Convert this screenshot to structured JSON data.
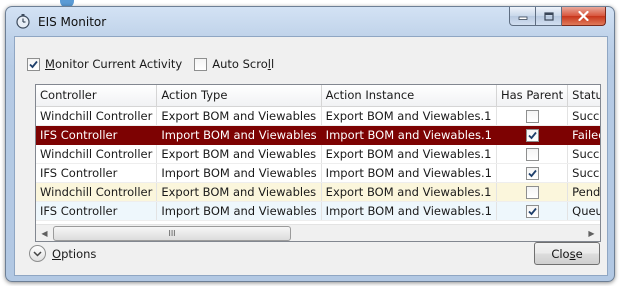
{
  "window": {
    "title": "EIS Monitor",
    "minimize_label": "Minimize",
    "maximize_label": "Maximize",
    "close_label": "Close window"
  },
  "toolbar": {
    "monitor_current_activity": {
      "pre": "",
      "u": "M",
      "post": "onitor Current Activity",
      "checked": true
    },
    "auto_scroll": {
      "pre": "Auto Scro",
      "u": "l",
      "post": "l",
      "checked": false
    }
  },
  "grid": {
    "columns": [
      "Controller",
      "Action Type",
      "Action Instance",
      "Has Parent",
      "Status"
    ],
    "rows": [
      {
        "controller": "Windchill Controller",
        "action_type": "Export BOM and Viewables",
        "action_instance": "Export BOM and Viewables.1",
        "has_parent": false,
        "status": "Succeeded",
        "state": "normal"
      },
      {
        "controller": "IFS Controller",
        "action_type": "Import BOM and Viewables",
        "action_instance": "Import BOM and Viewables.1",
        "has_parent": true,
        "status": "Failed",
        "state": "selected"
      },
      {
        "controller": "Windchill Controller",
        "action_type": "Export BOM and Viewables",
        "action_instance": "Export BOM and Viewables.1",
        "has_parent": false,
        "status": "Succeeded",
        "state": "normal"
      },
      {
        "controller": "IFS Controller",
        "action_type": "Import BOM and Viewables",
        "action_instance": "Import BOM and Viewables.1",
        "has_parent": true,
        "status": "Succeeded",
        "state": "normal"
      },
      {
        "controller": "Windchill Controller",
        "action_type": "Export BOM and Viewables",
        "action_instance": "Export BOM and Viewables.1",
        "has_parent": false,
        "status": "Pending",
        "state": "pending"
      },
      {
        "controller": "IFS Controller",
        "action_type": "Import BOM and Viewables",
        "action_instance": "Import BOM and Viewables.1",
        "has_parent": true,
        "status": "Queued",
        "state": "queued"
      }
    ],
    "scroll_thumb_grip": "III"
  },
  "footer": {
    "options": {
      "u": "O",
      "post": "ptions"
    },
    "close_button": {
      "pre": "Clo",
      "u": "s",
      "post": "e"
    }
  },
  "icons": {
    "app": "stopwatch-icon",
    "expander": "chevron-down-icon",
    "scroll_left": "arrow-left-icon",
    "scroll_right": "arrow-right-icon"
  },
  "colors": {
    "selected_row": "#7d0202",
    "pending_row": "#fbf6dc",
    "queued_row": "#eef7fc",
    "close_caption": "#c7361c"
  }
}
